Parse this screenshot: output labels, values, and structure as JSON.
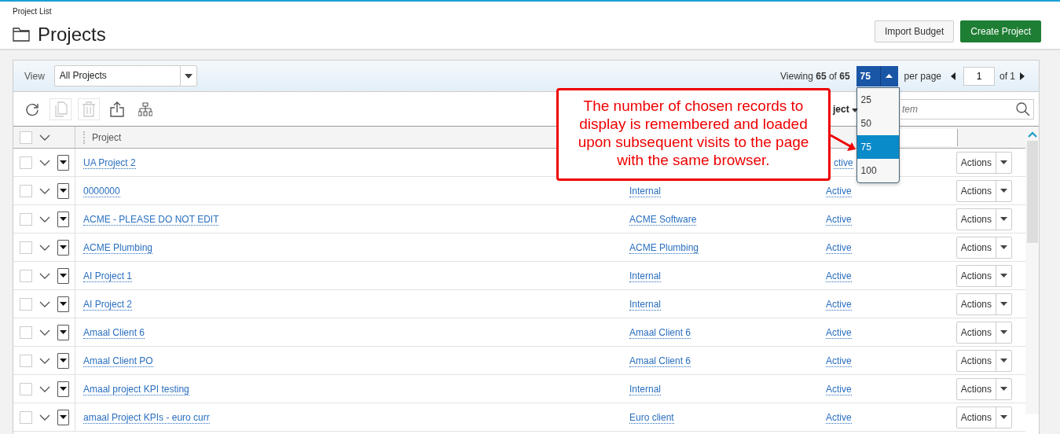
{
  "breadcrumb": "Project List",
  "title": "Projects",
  "buttons": [
    {
      "label": "Import Budget",
      "kind": "secondary"
    },
    {
      "label": "Create Project",
      "kind": "primary"
    }
  ],
  "view": {
    "label": "View",
    "value": "All Projects"
  },
  "paging": {
    "viewing": "Viewing **65** of **65**",
    "per_page_value": "75",
    "per_page_label": "per page",
    "page": "1",
    "of_pages": "of 1",
    "options": [
      {
        "label": "25",
        "selected": false
      },
      {
        "label": "50",
        "selected": false
      },
      {
        "label": "75",
        "selected": true
      },
      {
        "label": "100",
        "selected": false
      }
    ]
  },
  "toolbar": [
    {
      "kind": "refresh",
      "disabled": false
    },
    {
      "kind": "copy",
      "disabled": true
    },
    {
      "kind": "delete",
      "disabled": true
    },
    {
      "kind": "export",
      "disabled": false
    },
    {
      "kind": "hierarchy",
      "disabled": false
    }
  ],
  "filter": {
    "dropdown_label": "ject",
    "search_placeholder": "tem"
  },
  "table": {
    "select_all": {
      "checked": false
    },
    "columns": [
      "Project"
    ],
    "rows": [
      {
        "checked": false,
        "project": "UA Project 2",
        "status": "ctive",
        "action": "Actions"
      },
      {
        "checked": false,
        "project": "0000000",
        "client": "Internal",
        "status": "Active",
        "action": "Actions"
      },
      {
        "checked": false,
        "project": "ACME - PLEASE DO NOT EDIT",
        "client": "ACME Software",
        "status": "Active",
        "action": "Actions"
      },
      {
        "checked": false,
        "project": "ACME Plumbing",
        "client": "ACME Plumbing",
        "status": "Active",
        "action": "Actions"
      },
      {
        "checked": false,
        "project": "AI Project 1",
        "client": "Internal",
        "status": "Active",
        "action": "Actions"
      },
      {
        "checked": false,
        "project": "AI Project 2",
        "client": "Internal",
        "status": "Active",
        "action": "Actions"
      },
      {
        "checked": false,
        "project": "Amaal Client 6",
        "client": "Amaal Client 6",
        "status": "Active",
        "action": "Actions"
      },
      {
        "checked": false,
        "project": "Amaal Client PO",
        "client": "Amaal Client 6",
        "status": "Active",
        "action": "Actions"
      },
      {
        "checked": false,
        "project": "Amaal project KPI testing",
        "client": "Internal",
        "status": "Active",
        "action": "Actions"
      },
      {
        "checked": false,
        "project": "amaal Project KPIs - euro curr",
        "client": "Euro client",
        "status": "Active",
        "action": "Actions"
      }
    ]
  },
  "callout": {
    "text": "The number of chosen records to display is remembered and loaded upon subsequent visits to the page with the same browser."
  }
}
